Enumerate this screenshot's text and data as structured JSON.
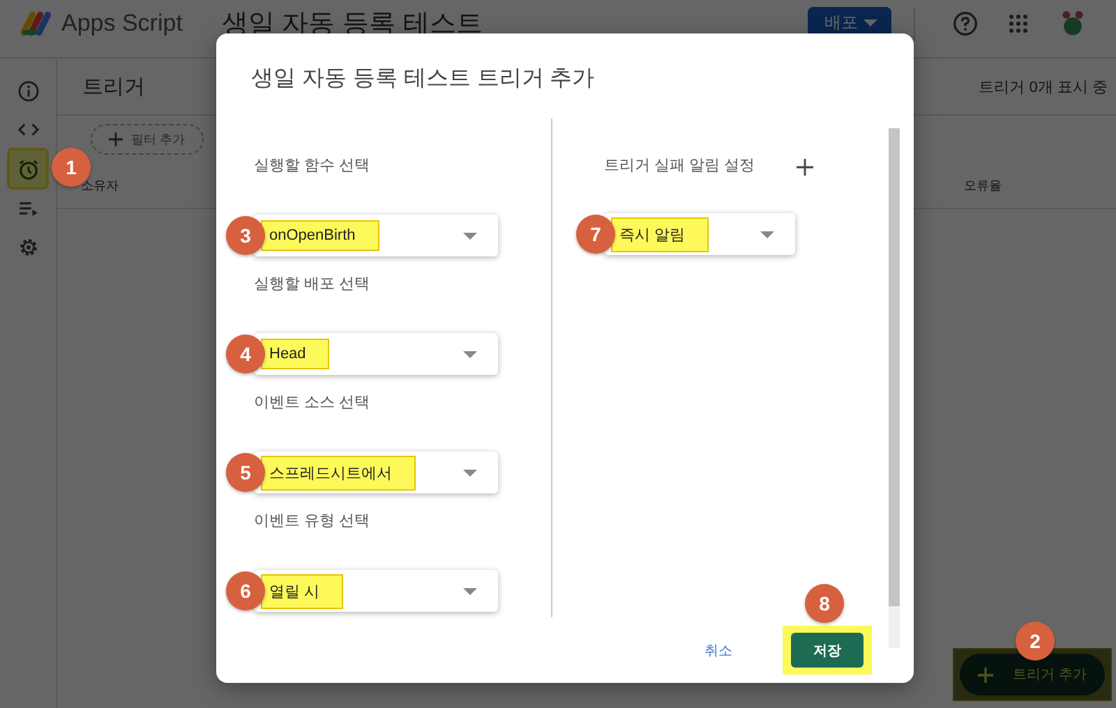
{
  "app": {
    "name": "Apps Script",
    "project_title": "생일 자동 등록 테스트",
    "deploy_button": "배포"
  },
  "sidebar": {
    "items": [
      {
        "kind": "info",
        "selected": false,
        "highlighted": false
      },
      {
        "kind": "code",
        "selected": false,
        "highlighted": false
      },
      {
        "kind": "triggers",
        "selected": true,
        "highlighted": true,
        "callout": "1"
      },
      {
        "kind": "executions",
        "selected": false,
        "highlighted": false
      },
      {
        "kind": "settings",
        "selected": false,
        "highlighted": false
      }
    ]
  },
  "page": {
    "heading": "트리거",
    "count": "트리거 0개 표시 중",
    "filter_chip": "필터 추가",
    "columns": [
      "소유자",
      "오류율"
    ],
    "fab": {
      "label": "트리거 추가",
      "highlighted": true,
      "callout": "2"
    }
  },
  "dialog": {
    "title": "생일 자동 등록 테스트 트리거 추가",
    "fields": [
      {
        "label": "실행할 함수 선택",
        "value": "onOpenBirth",
        "highlighted": true,
        "callout": "3"
      },
      {
        "label": "실행할 배포 선택",
        "value": "Head",
        "highlighted": true,
        "callout": "4"
      },
      {
        "label": "이벤트 소스 선택",
        "value": "스프레드시트에서",
        "highlighted": true,
        "callout": "5"
      },
      {
        "label": "이벤트 유형 선택",
        "value": "열릴 시",
        "highlighted": true,
        "callout": "6"
      }
    ],
    "notify": {
      "label": "트리거 실패 알림 설정",
      "value": "즉시 알림",
      "highlighted": true,
      "callout": "7"
    },
    "cancel": "취소",
    "save": {
      "label": "저장",
      "highlighted": true,
      "callout": "8"
    }
  }
}
